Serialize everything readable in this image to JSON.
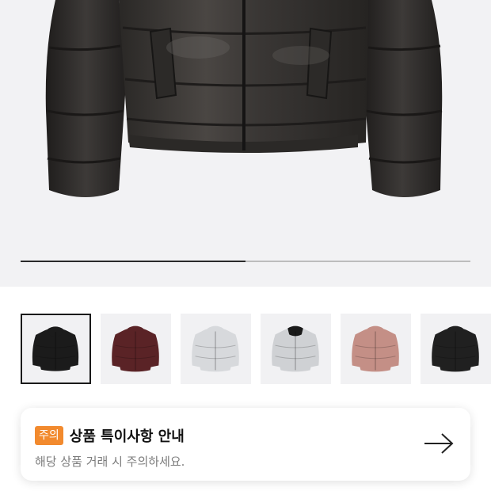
{
  "hero": {
    "image": "black-puffer-jacket-closeup",
    "slide_progress": 0.5
  },
  "thumbnails": [
    {
      "name": "black-glossy-puffer",
      "color": "#1b1b1b",
      "accent": "#1b1b1b",
      "selected": true
    },
    {
      "name": "burgundy-puffer",
      "color": "#5a2326",
      "accent": "#5a2326",
      "selected": false
    },
    {
      "name": "light-grey-puffer",
      "color": "#d7d9dc",
      "accent": "#d7d9dc",
      "selected": false
    },
    {
      "name": "black-white-puffer",
      "color": "#cfd1d4",
      "accent": "#1a1a1a",
      "selected": false
    },
    {
      "name": "dusty-pink-puffer",
      "color": "#c48f86",
      "accent": "#c48f86",
      "selected": false
    },
    {
      "name": "black-matte-puffer",
      "color": "#202020",
      "accent": "#202020",
      "selected": false
    }
  ],
  "notice": {
    "badge": "주의",
    "title": "상품 특이사항 안내",
    "subtitle": "해당 상품 거래 시 주의하세요.",
    "badge_color": "#f28a2e"
  }
}
